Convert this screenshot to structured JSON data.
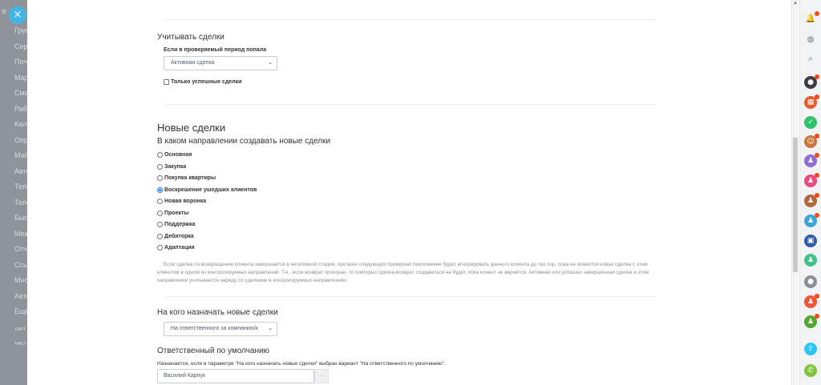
{
  "colors": {
    "accent": "#41b5e8",
    "radio_selected": "#1a73e8",
    "sidebar_bg": "#8f949a",
    "note_text": "#8a8f94"
  },
  "left_menu": {
    "items": [
      "Груп",
      "Серв",
      "Почт",
      "Марк",
      "Смар",
      "Рабо",
      "Кале",
      "Опро",
      "Майл",
      "Авто",
      "ТелР",
      "Теле",
      "Быст",
      "Меж",
      "Отч",
      "Ссыл",
      "Мно",
      "Авто",
      "Ещё"
    ],
    "small_items": [
      "КАРТ",
      "НАСТ"
    ]
  },
  "close_button": {
    "icon": "close-icon",
    "glyph": "×"
  },
  "deals_section": {
    "title": "Учитывать сделки",
    "period_label": "Если в проверяемый период попала",
    "period_select": "Активная сделка",
    "only_success_checkbox": "Только успешные сделки",
    "only_success_checked": false
  },
  "new_deals": {
    "title": "Новые сделки",
    "direction_label": "В каком направлении создавать новые сделки",
    "options": [
      {
        "label": "Основная",
        "checked": false
      },
      {
        "label": "Закупка",
        "checked": false
      },
      {
        "label": "Покупка квартиры",
        "checked": false
      },
      {
        "label": "Воскрешение ушедших клиентов",
        "checked": true
      },
      {
        "label": "Новая воронка",
        "checked": false
      },
      {
        "label": "Проекты",
        "checked": false
      },
      {
        "label": "Поддержка",
        "checked": false
      },
      {
        "label": "Дебиторка",
        "checked": false
      },
      {
        "label": "Адаптация",
        "checked": false
      }
    ],
    "note": "Если сделка по возвращению клиента завершается в негативной стадии, при всех следующих проверках приложение будет игнорировать данного клиента до тех пор, пока не появится новая сделка с этим клиентом в одном из контролируемых направлений. Т.е., если возврат проигран, то повторно сделка-возврат создаваться не будет, пока клиент не вернётся.      Активная или успешно завершённая сделка в этом направлении учитывается наряду со сделками в контролируемых направлениях."
  },
  "assign": {
    "title": "На кого назначать новые сделки",
    "select": "На ответственного за компанию/к"
  },
  "default_responsible": {
    "title": "Ответственный по умолчанию",
    "hint": "Назначается, если в параметре \"На кого назначать новые сделки\" выбран вариант \"На ответственного по умолчанию\".",
    "value": "Василий Карпук",
    "button": "..."
  },
  "right_bar": {
    "icons": [
      {
        "name": "bell-icon",
        "glyph": "🔔",
        "color": "plain",
        "badge": true
      },
      {
        "name": "messenger-icon",
        "glyph": "◍",
        "color": "plain",
        "badge": false
      },
      {
        "name": "search-icon",
        "glyph": "⌕",
        "color": "plain",
        "badge": false
      },
      {
        "name": "avatar-icon",
        "glyph": "●",
        "color": "#3b3f45",
        "badge": true
      },
      {
        "name": "calendar-icon",
        "glyph": "▦",
        "color": "#ea5b2c",
        "badge": true
      },
      {
        "name": "task-icon",
        "glyph": "✓",
        "color": "#2fc26b",
        "badge": false
      },
      {
        "name": "group-icon",
        "glyph": "☺",
        "color": "#c9763a",
        "badge": true
      },
      {
        "name": "user-icon",
        "glyph": "♟",
        "color": "#8e6ed1",
        "badge": true
      },
      {
        "name": "user-group-icon",
        "glyph": "♟",
        "color": "#e94a7f",
        "badge": true
      },
      {
        "name": "user-group-icon",
        "glyph": "♟",
        "color": "#b5683f",
        "badge": true
      },
      {
        "name": "user-group-icon",
        "glyph": "♟",
        "color": "#3ba7d9",
        "badge": true
      },
      {
        "name": "org-icon",
        "glyph": "▣",
        "color": "#2f5aa8",
        "badge": false
      },
      {
        "name": "user-icon",
        "glyph": "♟",
        "color": "#3ec288",
        "badge": false
      },
      {
        "name": "photo-avatar-icon",
        "glyph": "●",
        "color": "#8a9097",
        "badge": false
      },
      {
        "name": "user-icon",
        "glyph": "♟",
        "color": "#ef5636",
        "badge": true
      },
      {
        "name": "user-icon",
        "glyph": "♟",
        "color": "#55a82e",
        "badge": true
      },
      {
        "name": "share-icon",
        "glyph": "⇪",
        "color": "#2fc6f6",
        "badge": false
      },
      {
        "name": "phone-icon",
        "glyph": "✆",
        "color": "#7fc43b",
        "badge": false
      }
    ]
  }
}
